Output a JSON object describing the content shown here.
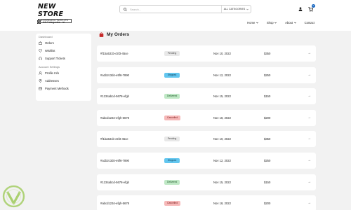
{
  "header": {
    "logo_main": "NEW STORE",
    "logo_sub": "ECOMMERCE TEMPLATE",
    "search_placeholder": "Search...",
    "search_category": "ALL CATEGORIES",
    "cart_count": "0",
    "category_dropdown": "All Categories",
    "nav": [
      "Home",
      "Shop",
      "About",
      "Contact"
    ]
  },
  "sidebar": {
    "section_dashboard": "Dashboard",
    "items_dashboard": [
      "Orders",
      "Wishlist",
      "Support Tickets"
    ],
    "section_account": "Account Settings",
    "items_account": [
      "Profile Info",
      "Addresses",
      "Payment Methods"
    ]
  },
  "main": {
    "title": "My Orders",
    "orders": [
      {
        "id": "#f1ba531b-c5f3-45ce",
        "status": "Pending",
        "status_type": "pending",
        "date": "Nov 10, 2022",
        "amount": "$350"
      },
      {
        "id": "#a1b2c3d4-e5f6-7890",
        "status": "Shipped",
        "status_type": "shipped",
        "date": "Nov 12, 2022",
        "amount": "$250"
      },
      {
        "id": "#1234abcd-5678-efgh",
        "status": "Delivered",
        "status_type": "delivered",
        "date": "Nov 15, 2022",
        "amount": "$150"
      },
      {
        "id": "#abcd1234-efgh-5678",
        "status": "Cancelled",
        "status_type": "cancelled",
        "date": "Nov 18, 2022",
        "amount": "$200"
      },
      {
        "id": "#f1ba531b-c5f3-45ce",
        "status": "Pending",
        "status_type": "pending",
        "date": "Nov 10, 2022",
        "amount": "$350"
      },
      {
        "id": "#a1b2c3d4-e5f6-7890",
        "status": "Shipped",
        "status_type": "shipped",
        "date": "Nov 12, 2022",
        "amount": "$250"
      },
      {
        "id": "#1234abcd-5678-efgh",
        "status": "Delivered",
        "status_type": "delivered",
        "date": "Nov 15, 2022",
        "amount": "$150"
      },
      {
        "id": "#abcd1234-efgh-5678",
        "status": "Cancelled",
        "status_type": "cancelled",
        "date": "Nov 18, 2022",
        "amount": "$200"
      }
    ],
    "row_arrow": "→"
  },
  "colors": {
    "accent": "#1565c0",
    "title_icon": "#c62828",
    "pending": "#e8e8e8",
    "shipped": "#62c6ef",
    "delivered": "#bfe8c5",
    "cancelled": "#f6b8b8"
  }
}
